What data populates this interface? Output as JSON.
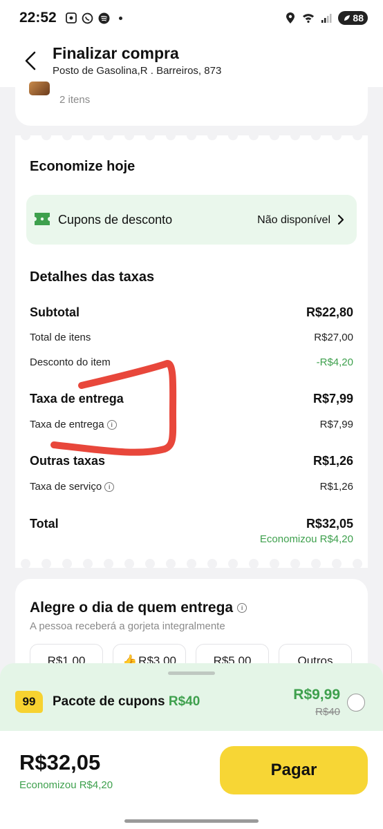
{
  "status_bar": {
    "time": "22:52",
    "battery": "88"
  },
  "header": {
    "title": "Finalizar compra",
    "subtitle": "Posto de Gasolina,R . Barreiros, 873"
  },
  "order": {
    "items_count": "2 itens"
  },
  "savings_section": {
    "title": "Economize hoje",
    "coupon_label": "Cupons de desconto",
    "coupon_status": "Não disponível"
  },
  "fees": {
    "title": "Detalhes das taxas",
    "rows": [
      {
        "label": "Subtotal",
        "value": "R$22,80",
        "bold": true
      },
      {
        "label": "Total de itens",
        "value": "R$27,00"
      },
      {
        "label": "Desconto do item",
        "value": "-R$4,20",
        "green": true
      },
      {
        "label": "Taxa de entrega",
        "value": "R$7,99",
        "bold": true
      },
      {
        "label": "Taxa de entrega",
        "value": "R$7,99",
        "info": true
      },
      {
        "label": "Outras taxas",
        "value": "R$1,26",
        "bold": true
      },
      {
        "label": "Taxa de serviço",
        "value": "R$1,26",
        "info": true
      },
      {
        "label": "Total",
        "value": "R$32,05",
        "bold": true
      }
    ],
    "saved_note": "Economizou R$4,20"
  },
  "tip": {
    "title": "Alegre o dia de quem entrega",
    "subtitle": "A pessoa receberá a gorjeta integralmente",
    "options": [
      "R$1,00",
      "R$3,00",
      "R$5,00",
      "Outros"
    ]
  },
  "coupon_pack": {
    "badge": "99",
    "label": "Pacote de cupons",
    "label_value": "R$40",
    "price": "R$9,99",
    "old_price": "R$40"
  },
  "footer": {
    "total": "R$32,05",
    "saved": "Economizou R$4,20",
    "pay_label": "Pagar"
  },
  "colors": {
    "accent_green": "#3ea04d",
    "pay_yellow": "#f7d635",
    "annotation_red": "#e8473b"
  }
}
